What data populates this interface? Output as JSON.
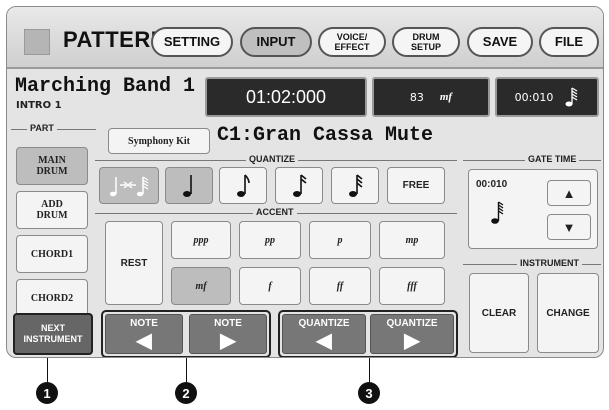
{
  "header": {
    "title": "PATTERN",
    "buttons": [
      {
        "label": "SETTING",
        "active": false
      },
      {
        "label": "INPUT",
        "active": true
      },
      {
        "label": "VOICE/\nEFFECT",
        "active": false
      },
      {
        "label": "DRUM\nSETUP",
        "active": false
      },
      {
        "label": "SAVE",
        "active": false
      },
      {
        "label": "FILE",
        "active": false
      }
    ]
  },
  "status": {
    "song_name": "Marching Band 1",
    "section": "INTRO 1",
    "time": "01:02:000",
    "velocity_value": "83",
    "velocity_mark": "mf",
    "gate": "00:010"
  },
  "part": {
    "label": "PART",
    "buttons": [
      "MAIN\nDRUM",
      "ADD\nDRUM",
      "CHORD1",
      "CHORD2"
    ],
    "selected": "MAIN\nDRUM"
  },
  "kit_button": "Symphony Kit",
  "instrument_name": "C1:Gran Cassa Mute",
  "quantize": {
    "label": "QUANTIZE",
    "free_label": "FREE"
  },
  "accent": {
    "label": "ACCENT",
    "rest_label": "REST",
    "levels": [
      "ppp",
      "pp",
      "p",
      "mp",
      "mf",
      "f",
      "ff",
      "fff"
    ],
    "selected": "mf"
  },
  "gate_time": {
    "label": "GATE TIME",
    "value": "00:010"
  },
  "instrument": {
    "label": "INSTRUMENT",
    "clear": "CLEAR",
    "change": "CHANGE"
  },
  "bottom": {
    "next_instrument": "NEXT\nINSTRUMENT",
    "note_left": "NOTE",
    "note_right": "NOTE",
    "quantize_left": "QUANTIZE",
    "quantize_right": "QUANTIZE"
  },
  "callouts": [
    "1",
    "2",
    "3"
  ],
  "colors": {
    "screen_bg": "#e4e4e4",
    "display_bg": "#2a2a2a",
    "selected": "#bdbdbd",
    "arrow_btn": "#777777"
  }
}
